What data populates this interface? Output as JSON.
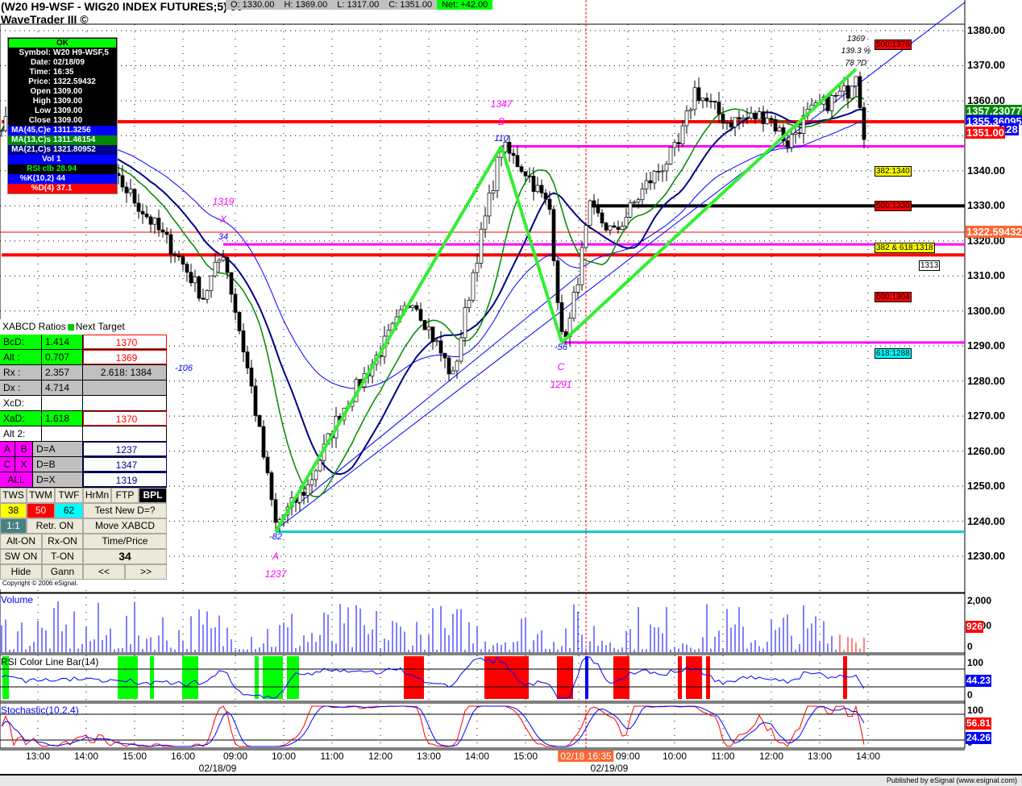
{
  "header": {
    "title": "(W20 H9-WSF - WIG20 INDEX FUTURES;5) 50",
    "subtitle": "WaveTrader III ©",
    "open": "O: 1330.00",
    "high": "H: 1369.00",
    "low": "L: 1317.00",
    "close": "C: 1351.00",
    "net": "Net: +42.00"
  },
  "info": {
    "ok": "OK",
    "rows": [
      [
        "Symbol:",
        "W20 H9-WSF,5"
      ],
      [
        "Date:",
        "02/18/09"
      ],
      [
        "Time:",
        "16:35"
      ],
      [
        "Price:",
        "1322.59432"
      ],
      [
        "Open",
        "1309.00"
      ],
      [
        "High",
        "1309.00"
      ],
      [
        "Low",
        "1309.00"
      ],
      [
        "Close",
        "1309.00"
      ],
      [
        "MA(45,C)e",
        "1311.3256"
      ],
      [
        "MA(13,C)s",
        "1311.46154"
      ],
      [
        "MA(21,C)s",
        "1321.80952"
      ],
      [
        "Vol",
        "1"
      ],
      [
        "RSI clb",
        "28.94"
      ],
      [
        "%K(10,2)",
        "44"
      ],
      [
        "%D(4)",
        "37.1"
      ]
    ]
  },
  "xabcd": {
    "header": "XABCD Ratios",
    "header2": "Next Target",
    "rows": [
      [
        "BcD:",
        "1.414",
        "1370"
      ],
      [
        "Alt  :",
        "0.707",
        "1369"
      ],
      [
        "Rx   :",
        "2.357",
        "2.618: 1384"
      ],
      [
        "Dx   :",
        "4.714",
        ""
      ],
      [
        "XcD:",
        "",
        ""
      ],
      [
        "XaD:",
        "1.618",
        "1370"
      ],
      [
        "Alt 2:",
        "",
        ""
      ]
    ],
    "pts": [
      [
        "A",
        "B",
        "D=A",
        "1237"
      ],
      [
        "C",
        "X",
        "D=B",
        "1347"
      ],
      [
        "ALL",
        "",
        "D=X",
        "1319"
      ]
    ],
    "buttons": {
      "tws": "TWS",
      "twm": "TWM",
      "twf": "TWF",
      "hrmn": "HrMn",
      "ftp": "FTP",
      "bpl": "BPL",
      "b38": "38",
      "b50": "50",
      "b62": "62",
      "test": "Test New D=?",
      "ratio": "1:1",
      "retr": "Retr. ON",
      "move": "Move XABCD",
      "alt": "Alt-ON",
      "rx": "Rx-ON",
      "timeprice": "Time/Price",
      "sw": "SW ON",
      "t": "T-ON",
      "num": "34",
      "hide": "Hide",
      "gann": "Gann",
      "prev": "<<",
      "next": ">>"
    },
    "copyright": "Copyright © 2006 eSignal."
  },
  "chart_labels": {
    "x_price": "1319",
    "x": "X",
    "x_bars": "34",
    "b_price": "1347",
    "b": "B",
    "b_bars": "110",
    "c_bars": "-56",
    "c": "C",
    "c_price": "1291",
    "a_bars": "-82",
    "a": "A",
    "a_price": "1237",
    "n106": "-106",
    "d_price": "1369",
    "d_pct": "139.3 %",
    "d_lab": "78 ?D"
  },
  "boxes": {
    "b1376": "500:1376",
    "b1340": "382:1340",
    "b1330": "500:1330",
    "b1318": "382 & 618:1318",
    "b1313": "1313",
    "b1304": "500:1304",
    "b1288": "618:1288"
  },
  "price_axis": [
    "1380.00",
    "1370.00",
    "1360.00",
    "1340.00",
    "1330.00",
    "1320.00",
    "1310.00",
    "1300.00",
    "1290.00",
    "1280.00",
    "1270.00",
    "1260.00",
    "1250.00",
    "1240.00",
    "1230.00"
  ],
  "tags": {
    "ma13": "1357.23077",
    "ma45": "1355.36095",
    "close": "1351.00",
    "ma21": "128",
    "cursor": "1322.59432",
    "vol": "926",
    "rsi": "44.23",
    "stk": "56.81",
    "std": "24.26"
  },
  "panels": {
    "volume": "Volume",
    "vol_max": "2,000",
    "vol_mid": "1,000",
    "vol_min": "0",
    "rsi": "RSI Color Line Bar(14)",
    "rsi_max": "100",
    "rsi_min": "0",
    "stoch": "Stochastic(10,2,4)",
    "st_max": "100",
    "st_min": "0"
  },
  "time_axis": [
    "13:00",
    "14:00",
    "15:00",
    "16:00",
    "09:00",
    "10:00",
    "11:00",
    "12:00",
    "13:00",
    "14:00",
    "15:00",
    "09:00",
    "10:00",
    "11:00",
    "12:00",
    "13:00",
    "14:00"
  ],
  "dates": [
    "02/18/09",
    "02/19/09"
  ],
  "cursor_time": "02/18 16:35",
  "footer": "Published by eSignal (www.esignal.com)",
  "chart_data": {
    "type": "candlestick",
    "ylim": [
      1225,
      1388
    ],
    "price_path": [
      [
        0,
        1354
      ],
      [
        30,
        1336
      ],
      [
        43,
        1317
      ],
      [
        50,
        1304
      ],
      [
        55,
        1317
      ],
      [
        62,
        1278
      ],
      [
        68,
        1239
      ],
      [
        76,
        1250
      ],
      [
        84,
        1271
      ],
      [
        92,
        1285
      ],
      [
        102,
        1304
      ],
      [
        109,
        1288
      ],
      [
        112,
        1281
      ],
      [
        117,
        1311
      ],
      [
        124,
        1347
      ],
      [
        130,
        1340
      ],
      [
        136,
        1329
      ],
      [
        139,
        1292
      ],
      [
        141,
        1297
      ],
      [
        146,
        1329
      ],
      [
        152,
        1322
      ],
      [
        160,
        1336
      ],
      [
        168,
        1347
      ],
      [
        172,
        1363
      ],
      [
        180,
        1354
      ],
      [
        190,
        1356
      ],
      [
        195,
        1348
      ],
      [
        200,
        1356
      ],
      [
        210,
        1363
      ],
      [
        212,
        1369
      ],
      [
        214,
        1351
      ]
    ],
    "levels": [
      {
        "price": 1354,
        "color": "#ff0000"
      },
      {
        "price": 1316,
        "color": "#ff0000"
      },
      {
        "price": 1347,
        "color": "#ff00ff"
      },
      {
        "price": 1319,
        "color": "#ff00ff"
      },
      {
        "price": 1291,
        "color": "#ff00ff"
      },
      {
        "price": 1237,
        "color": "#00cccc"
      },
      {
        "price": 1330,
        "color": "#000000"
      }
    ],
    "pattern": [
      [
        55,
        1319
      ],
      [
        68,
        1237
      ],
      [
        124,
        1347
      ],
      [
        139,
        1291
      ],
      [
        212,
        1369
      ]
    ]
  }
}
